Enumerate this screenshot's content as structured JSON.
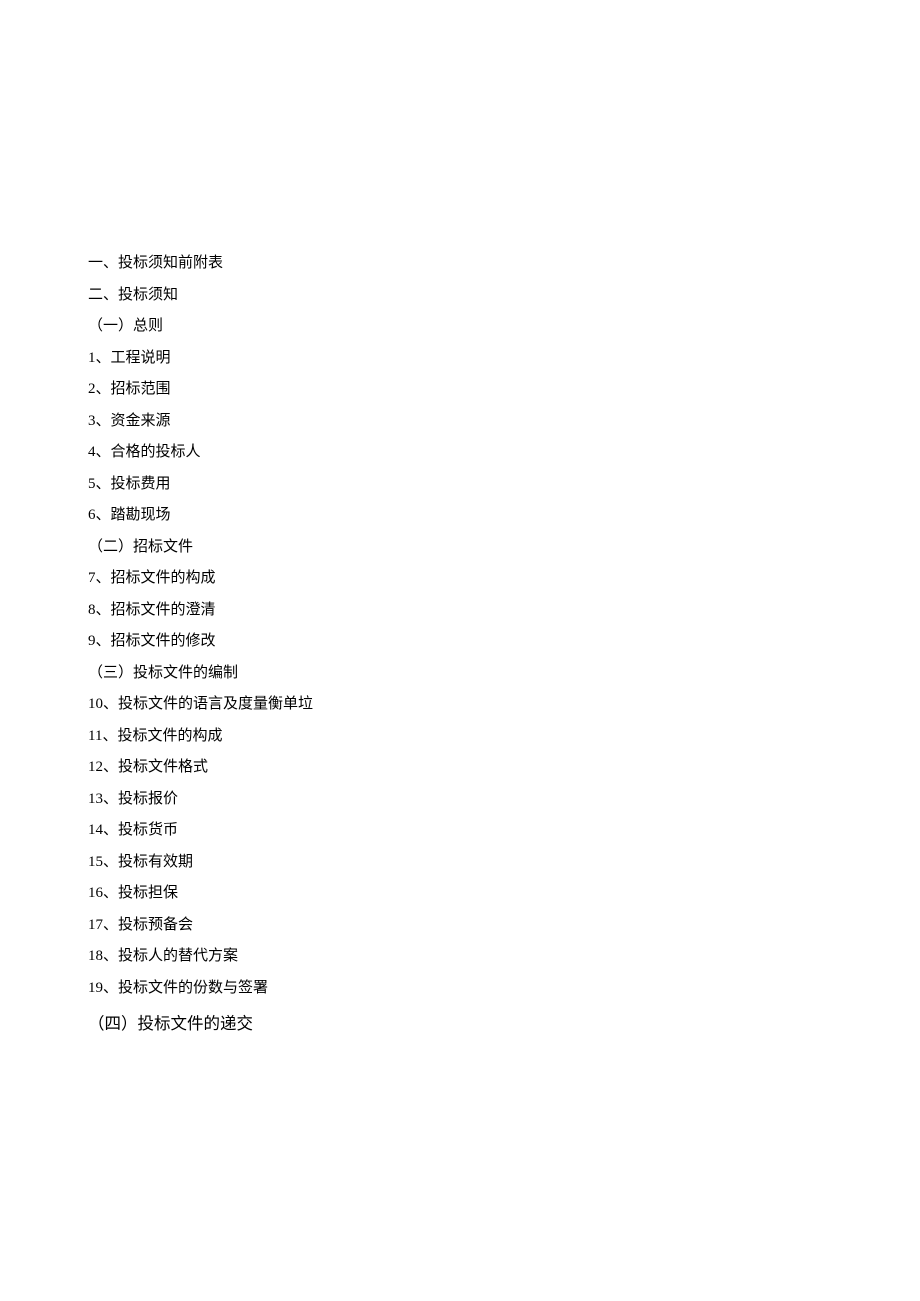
{
  "lines": [
    "一、投标须知前附表",
    "二、投标须知",
    "（一）总则",
    "1、工程说明",
    "2、招标范围",
    "3、资金来源",
    "4、合格的投标人",
    "5、投标费用",
    "6、踏勘现场",
    "（二）招标文件",
    "7、招标文件的构成",
    "8、招标文件的澄清",
    "9、招标文件的修改",
    "（三）投标文件的编制",
    "10、投标文件的语言及度量衡单垃",
    "11、投标文件的构成",
    "12、投标文件格式",
    "13、投标报价",
    "14、投标货币",
    "15、投标有效期",
    "16、投标担保",
    "17、投标预备会",
    "18、投标人的替代方案",
    "19、投标文件的份数与签署"
  ],
  "finalLine": "（四）投标文件的递交"
}
